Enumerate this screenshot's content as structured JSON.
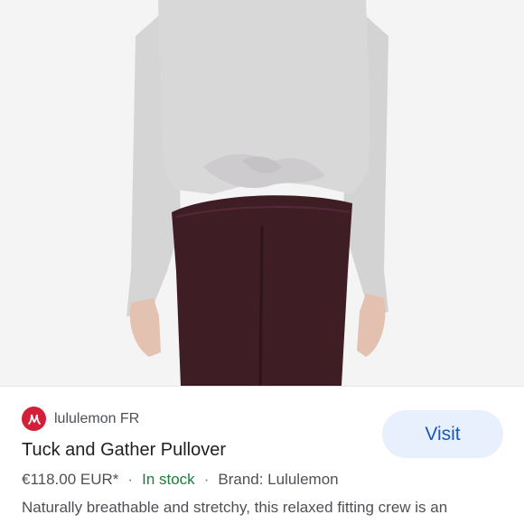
{
  "result": {
    "source_name": "lululemon FR",
    "visit_label": "Visit",
    "title": "Tuck and Gather Pullover",
    "price": "€118.00 EUR*",
    "separator": "·",
    "stock_status": "In stock",
    "brand": "Brand: Lululemon",
    "description": "Naturally breathable and stretchy, this relaxed fitting crew is an"
  },
  "colors": {
    "brand_red": "#d31f37",
    "visit_bg": "#e8f0fe",
    "visit_text": "#1a57b8",
    "in_stock": "#188038"
  },
  "icons": {
    "logo": "lululemon-logo-icon"
  }
}
